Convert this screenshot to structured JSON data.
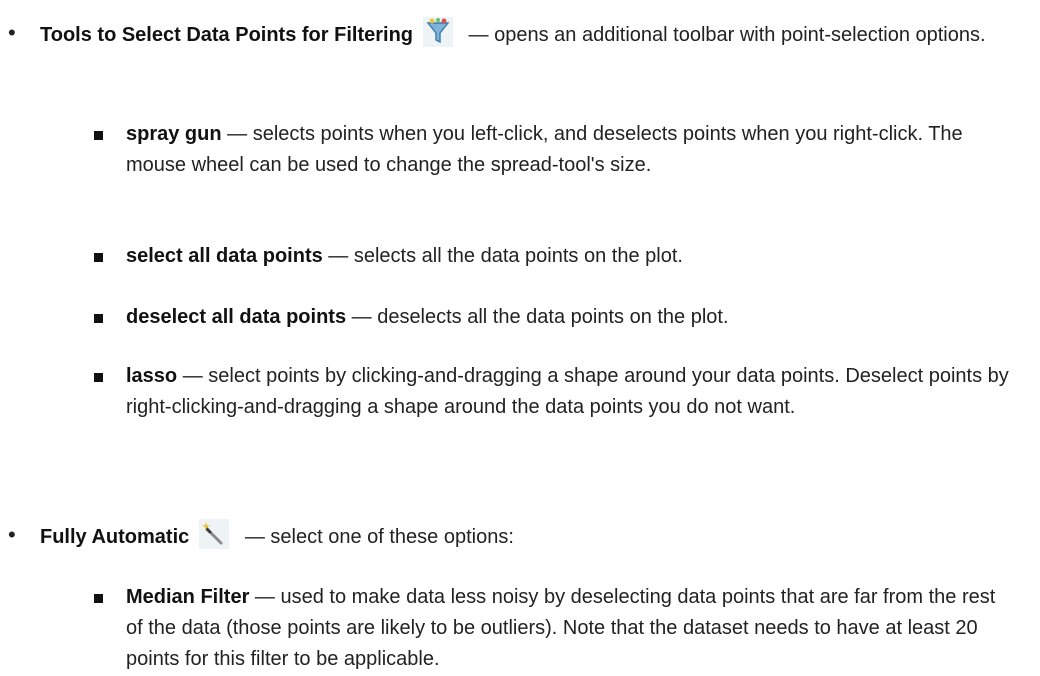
{
  "items": [
    {
      "title": "Tools to Select Data Points for Filtering",
      "icon": "funnel-filter-icon",
      "description": " — opens an additional toolbar with point-selection options.",
      "subitems": [
        {
          "term": "spray gun",
          "text": " — selects points when you left-click, and deselects points when you right-click. The mouse wheel can be used to change the spread-tool's size."
        },
        {
          "term": "select all data points",
          "text": " — selects all the data points on the plot."
        },
        {
          "term": "deselect all data points",
          "text": " — deselects all the data points on the plot."
        },
        {
          "term": "lasso",
          "text": " — select points by clicking-and-dragging a shape around your data points. Deselect points by right-clicking-and-dragging a shape around the data points you do not want."
        }
      ]
    },
    {
      "title": "Fully Automatic",
      "icon": "magic-wand-icon",
      "description": " — select one of these options:",
      "subitems": [
        {
          "term": "Median Filter",
          "text": " — used to make data less noisy by deselecting data points that are far from the rest of the data (those points are likely to be outliers). Note that the dataset needs to have at least 20 points for this filter to be applicable."
        }
      ]
    }
  ]
}
